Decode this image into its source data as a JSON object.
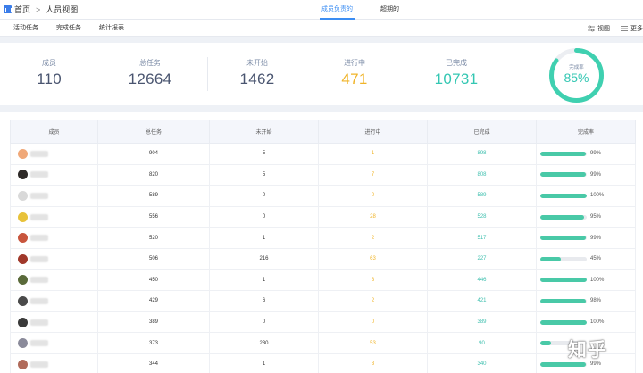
{
  "breadcrumb": {
    "home": "首页",
    "current": "人员视图"
  },
  "top_tabs": [
    {
      "label": "成员负责的",
      "active": true
    },
    {
      "label": "超期的",
      "active": false
    }
  ],
  "sub_tabs": [
    "活动任务",
    "完成任务",
    "统计报表"
  ],
  "sub_actions": {
    "view": "视图",
    "more": "更多"
  },
  "stats": {
    "members": {
      "label": "成员",
      "value": "110"
    },
    "total": {
      "label": "总任务",
      "value": "12664"
    },
    "not_started": {
      "label": "未开始",
      "value": "1462"
    },
    "in_progress": {
      "label": "进行中",
      "value": "471"
    },
    "done": {
      "label": "已完成",
      "value": "10731"
    },
    "completion": {
      "label": "完成率",
      "value": "85%",
      "fraction": 0.85
    }
  },
  "colors": {
    "accent": "#3b8df3",
    "orange": "#f0b429",
    "teal": "#34c7b3",
    "bar": "#49c9a7"
  },
  "table": {
    "headers": [
      "成员",
      "总任务",
      "未开始",
      "进行中",
      "已完成",
      "完成率"
    ],
    "rows": [
      {
        "avatar_text": "SR",
        "avatar_color": "#f0a878",
        "total": "904",
        "not_started": "5",
        "in_progress": "1",
        "done": "898",
        "rate": "99%",
        "rate_fraction": 0.99
      },
      {
        "avatar_text": "",
        "avatar_color": "#2e2a28",
        "total": "820",
        "not_started": "5",
        "in_progress": "7",
        "done": "808",
        "rate": "99%",
        "rate_fraction": 0.99
      },
      {
        "avatar_text": "",
        "avatar_color": "#d9d9d9",
        "total": "589",
        "not_started": "0",
        "in_progress": "0",
        "done": "589",
        "rate": "100%",
        "rate_fraction": 1.0
      },
      {
        "avatar_text": "",
        "avatar_color": "#e8c23a",
        "total": "556",
        "not_started": "0",
        "in_progress": "28",
        "done": "528",
        "rate": "95%",
        "rate_fraction": 0.95
      },
      {
        "avatar_text": "",
        "avatar_color": "#c8553d",
        "total": "520",
        "not_started": "1",
        "in_progress": "2",
        "done": "517",
        "rate": "99%",
        "rate_fraction": 0.99
      },
      {
        "avatar_text": "",
        "avatar_color": "#a0382a",
        "total": "506",
        "not_started": "216",
        "in_progress": "63",
        "done": "227",
        "rate": "45%",
        "rate_fraction": 0.45
      },
      {
        "avatar_text": "",
        "avatar_color": "#5a6a3a",
        "total": "450",
        "not_started": "1",
        "in_progress": "3",
        "done": "446",
        "rate": "100%",
        "rate_fraction": 1.0
      },
      {
        "avatar_text": "",
        "avatar_color": "#4a4a4a",
        "total": "429",
        "not_started": "6",
        "in_progress": "2",
        "done": "421",
        "rate": "98%",
        "rate_fraction": 0.98
      },
      {
        "avatar_text": "",
        "avatar_color": "#3a3a3a",
        "total": "389",
        "not_started": "0",
        "in_progress": "0",
        "done": "389",
        "rate": "100%",
        "rate_fraction": 1.0
      },
      {
        "avatar_text": "",
        "avatar_color": "#8a8a9a",
        "total": "373",
        "not_started": "230",
        "in_progress": "53",
        "done": "90",
        "rate": "",
        "rate_fraction": 0.24
      },
      {
        "avatar_text": "",
        "avatar_color": "#b06a5a",
        "total": "344",
        "not_started": "1",
        "in_progress": "3",
        "done": "340",
        "rate": "99%",
        "rate_fraction": 0.99
      }
    ]
  },
  "watermark": "知乎"
}
